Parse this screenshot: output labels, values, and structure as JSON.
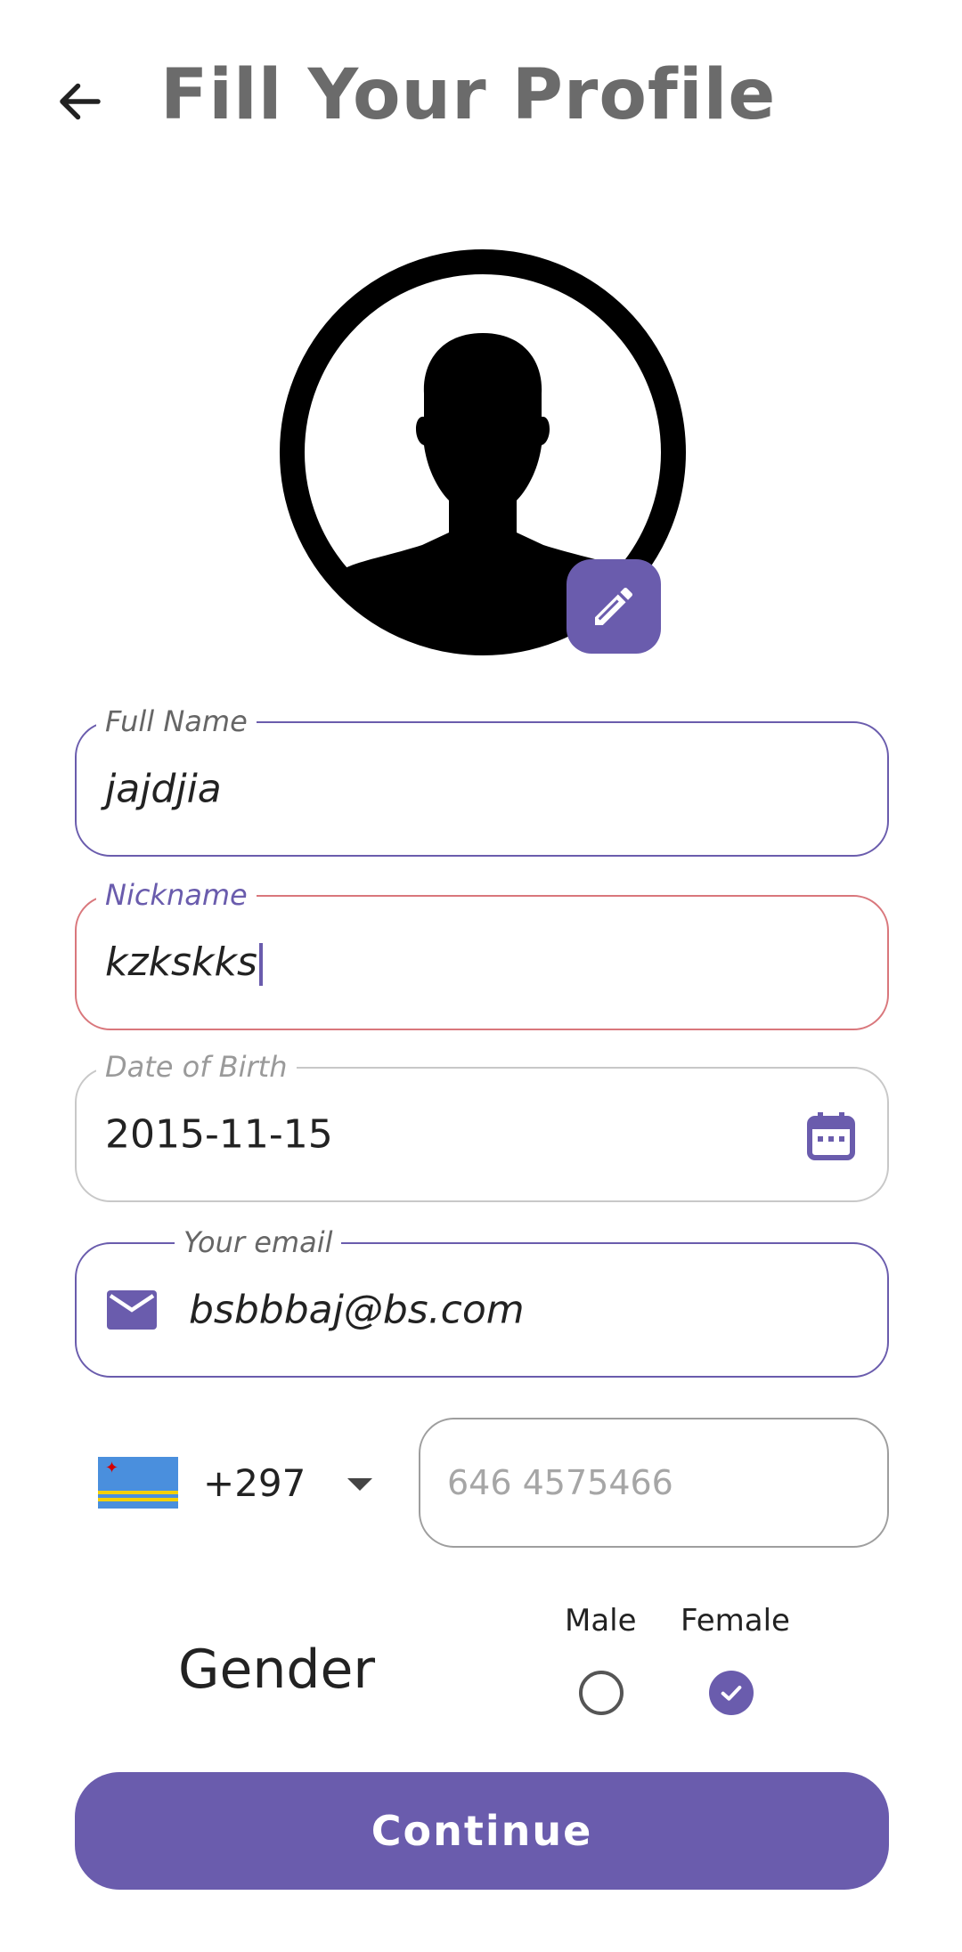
{
  "header": {
    "title": "Fill Your Profile",
    "back_icon": "arrow-left-icon"
  },
  "avatar": {
    "icon": "user-silhouette-icon",
    "edit_icon": "pencil-icon",
    "edit_bg": "#6a5cad"
  },
  "form": {
    "full_name": {
      "label": "Full Name",
      "value": "jajdjia"
    },
    "nickname": {
      "label": "Nickname",
      "value": "kzkskks"
    },
    "dob": {
      "label": "Date of Birth",
      "value": "2015-11-15",
      "icon": "calendar-icon"
    },
    "email": {
      "label": "Your email",
      "value": "bsbbbaj@bs.com",
      "icon": "mail-icon"
    },
    "phone": {
      "country_flag": "aruba-flag",
      "dial_code": "+297",
      "placeholder": "646 4575466",
      "dropdown_icon": "caret-down-icon"
    },
    "gender": {
      "label": "Gender",
      "options": [
        {
          "label": "Male",
          "selected": false
        },
        {
          "label": "Female",
          "selected": true
        }
      ]
    }
  },
  "actions": {
    "continue_label": "Continue"
  },
  "colors": {
    "accent": "#6a5cad",
    "error_border": "#d9777c",
    "neutral_border": "#c8c8c8"
  }
}
